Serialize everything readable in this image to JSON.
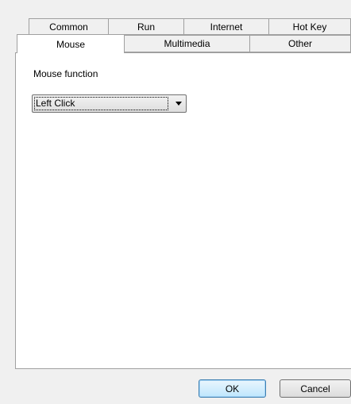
{
  "tabs": {
    "row1": [
      "Common",
      "Run",
      "Internet",
      "Hot Key"
    ],
    "row2": [
      "Mouse",
      "Multimedia",
      "Other"
    ],
    "selected": "Mouse"
  },
  "mouse_function": {
    "label": "Mouse function",
    "selected_value": "Left Click"
  },
  "buttons": {
    "ok": "OK",
    "cancel": "Cancel"
  }
}
